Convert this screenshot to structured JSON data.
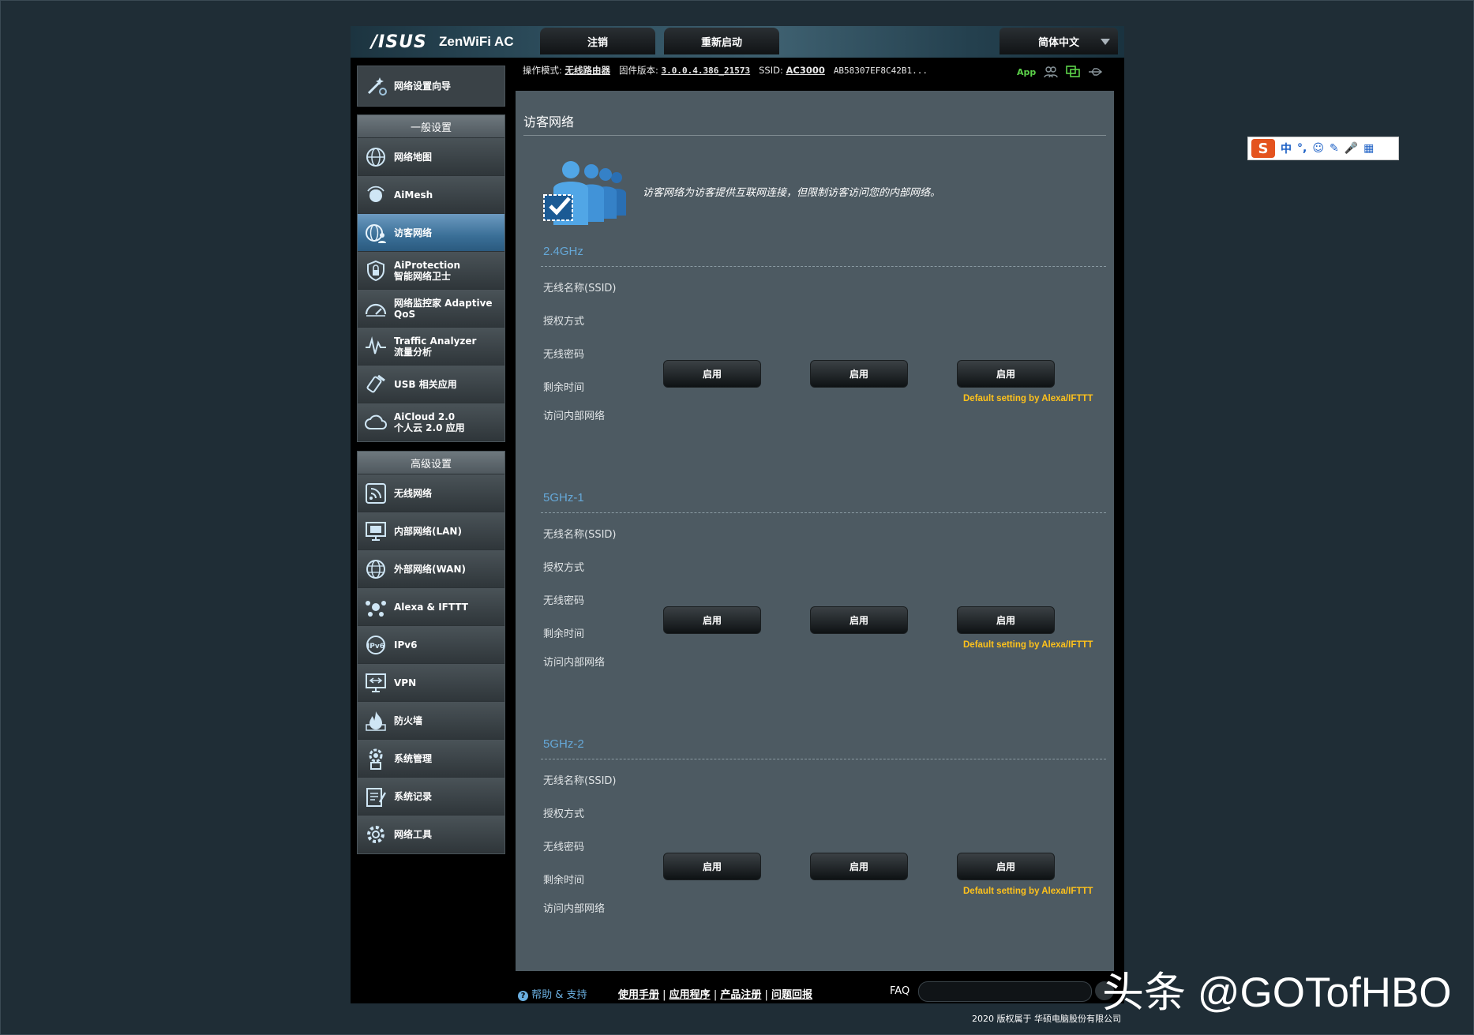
{
  "header": {
    "logo": "/ISUS",
    "model": "ZenWiFi AC",
    "logout_label": "注销",
    "reboot_label": "重新启动",
    "language_label": "简体中文"
  },
  "status": {
    "mode_label": "操作模式:",
    "mode_value": "无线路由器",
    "firmware_label": "固件版本:",
    "firmware_value": "3.0.0.4.386_21573",
    "ssid_label": "SSID:",
    "ssid_value": "AC3000",
    "ssid_value2": "AB58307EF8C42B1...",
    "app_label": "App"
  },
  "sidebar": {
    "wizard_label": "网络设置向导",
    "general_header": "一般设置",
    "general_items": [
      {
        "label": "网络地图",
        "icon": "globe-network-icon"
      },
      {
        "label": "AiMesh",
        "icon": "aimesh-router-icon"
      },
      {
        "label": "访客网络",
        "icon": "guest-network-icon",
        "active": true
      },
      {
        "label": "AiProtection\n智能网络卫士",
        "icon": "shield-lock-icon"
      },
      {
        "label": "网络监控家 Adaptive\nQoS",
        "icon": "gauge-icon"
      },
      {
        "label": "Traffic Analyzer\n流量分析",
        "icon": "waveform-icon"
      },
      {
        "label": "USB 相关应用",
        "icon": "usb-icon"
      },
      {
        "label": "AiCloud 2.0\n个人云 2.0 应用",
        "icon": "cloud-icon"
      }
    ],
    "advanced_header": "高级设置",
    "advanced_items": [
      {
        "label": "无线网络",
        "icon": "wifi-icon"
      },
      {
        "label": "内部网络(LAN)",
        "icon": "lan-monitor-icon"
      },
      {
        "label": "外部网络(WAN)",
        "icon": "wan-globe-icon"
      },
      {
        "label": "Alexa & IFTTT",
        "icon": "alexa-icon"
      },
      {
        "label": "IPv6",
        "icon": "ipv6-icon"
      },
      {
        "label": "VPN",
        "icon": "vpn-icon"
      },
      {
        "label": "防火墙",
        "icon": "firewall-icon"
      },
      {
        "label": "系统管理",
        "icon": "admin-gear-icon"
      },
      {
        "label": "系统记录",
        "icon": "syslog-icon"
      },
      {
        "label": "网络工具",
        "icon": "network-tools-icon"
      }
    ]
  },
  "main": {
    "title": "访客网络",
    "description": "访客网络为访客提供互联网连接，但限制访客访问您的内部网络。",
    "row_labels": [
      "无线名称(SSID)",
      "授权方式",
      "无线密码",
      "剩余时间",
      "访问内部网络"
    ],
    "enable_label": "启用",
    "alexa_note": "Default setting by Alexa/IFTTT",
    "bands": [
      "2.4GHz",
      "5GHz-1",
      "5GHz-2"
    ]
  },
  "footer": {
    "help_label": "帮助 & 支持",
    "links": [
      "使用手册",
      "应用程序",
      "产品注册",
      "问题回报"
    ],
    "faq_label": "FAQ",
    "copyright": "2020 版权属于 华硕电脑股份有限公司"
  },
  "ime": {
    "items": [
      "中",
      "°,",
      "☺",
      "✎",
      "🎤",
      "▦"
    ]
  },
  "watermark": "头条 @GOTofHBO"
}
